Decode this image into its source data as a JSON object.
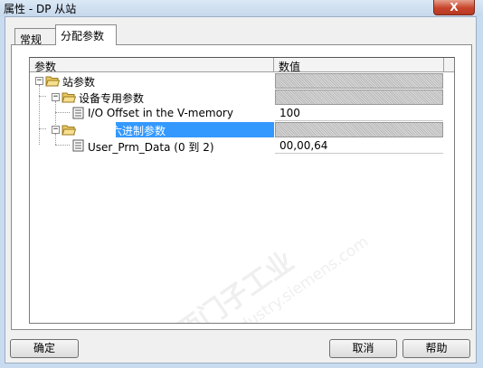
{
  "window": {
    "title": "属性 - DP 从站",
    "close_label": "X"
  },
  "tabs": [
    {
      "label": "常规",
      "active": false
    },
    {
      "label": "分配参数",
      "active": true
    }
  ],
  "table": {
    "headers": {
      "param": "参数",
      "value": "数值"
    },
    "rows": [
      {
        "label": "站参数",
        "value": "",
        "type": "folder",
        "expanded": true,
        "level": 0
      },
      {
        "label": "设备专用参数",
        "value": "",
        "type": "folder",
        "expanded": true,
        "level": 1
      },
      {
        "label": "I/O Offset in the V-memory",
        "value": "100",
        "type": "item",
        "level": 2
      },
      {
        "label": "分配十六进制参数",
        "value": "",
        "type": "folder",
        "expanded": true,
        "level": 1,
        "selected": true
      },
      {
        "label": "User_Prm_Data (0 到 2)",
        "value": "00,00,64",
        "type": "item",
        "level": 2
      }
    ]
  },
  "buttons": {
    "ok": "确定",
    "cancel": "取消",
    "help": "帮助"
  },
  "watermark": {
    "line1": "西门子工业",
    "line2": "support.industry.siemens.com"
  },
  "colors": {
    "selection": "#3399ff",
    "folder": "#e8c860",
    "close": "#c7442b"
  }
}
